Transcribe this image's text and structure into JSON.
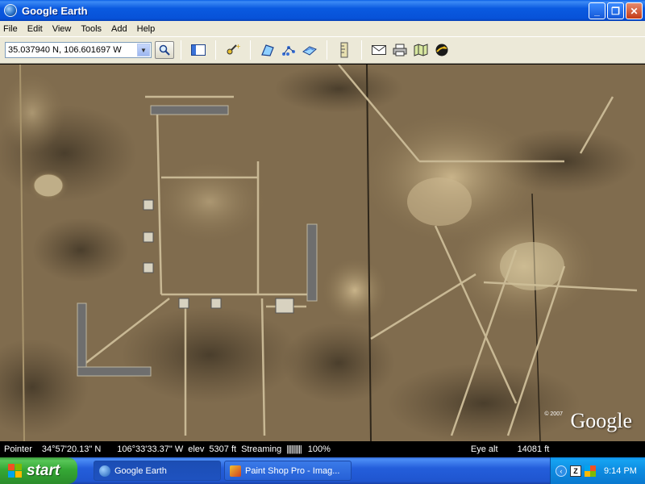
{
  "window": {
    "title": "Google Earth",
    "buttons": {
      "minimize": "_",
      "maximize": "❐",
      "close": "✕"
    }
  },
  "menu": [
    "File",
    "Edit",
    "View",
    "Tools",
    "Add",
    "Help"
  ],
  "toolbar": {
    "coordinates_value": "35.037940 N, 106.601697 W",
    "icons": [
      "search-icon",
      "sidebar-icon",
      "placemark-icon",
      "polygon-icon",
      "path-icon",
      "image-overlay-icon",
      "ruler-icon",
      "email-icon",
      "print-icon",
      "google-maps-icon",
      "sky-icon"
    ]
  },
  "map": {
    "watermark": "Google",
    "copyright": "© 2007"
  },
  "status": {
    "pointer_label": "Pointer",
    "lat": "34°57'20.13\" N",
    "lon": "106°33'33.37\" W",
    "elev_label": "elev",
    "elev": "5307 ft",
    "streaming_label": "Streaming",
    "streaming_bars": "||||||||||",
    "streaming_pct": "100%",
    "eye_alt_label": "Eye alt",
    "eye_alt": "14081 ft"
  },
  "taskbar": {
    "start_label": "start",
    "tasks": [
      {
        "label": "Google Earth",
        "active": true
      },
      {
        "label": "Paint Shop Pro - Imag...",
        "active": false
      }
    ],
    "clock": "9:14 PM"
  },
  "colors": {
    "title_blue": "#0752d8",
    "chrome": "#ece9d8",
    "terrain": "#7d6a4d"
  }
}
